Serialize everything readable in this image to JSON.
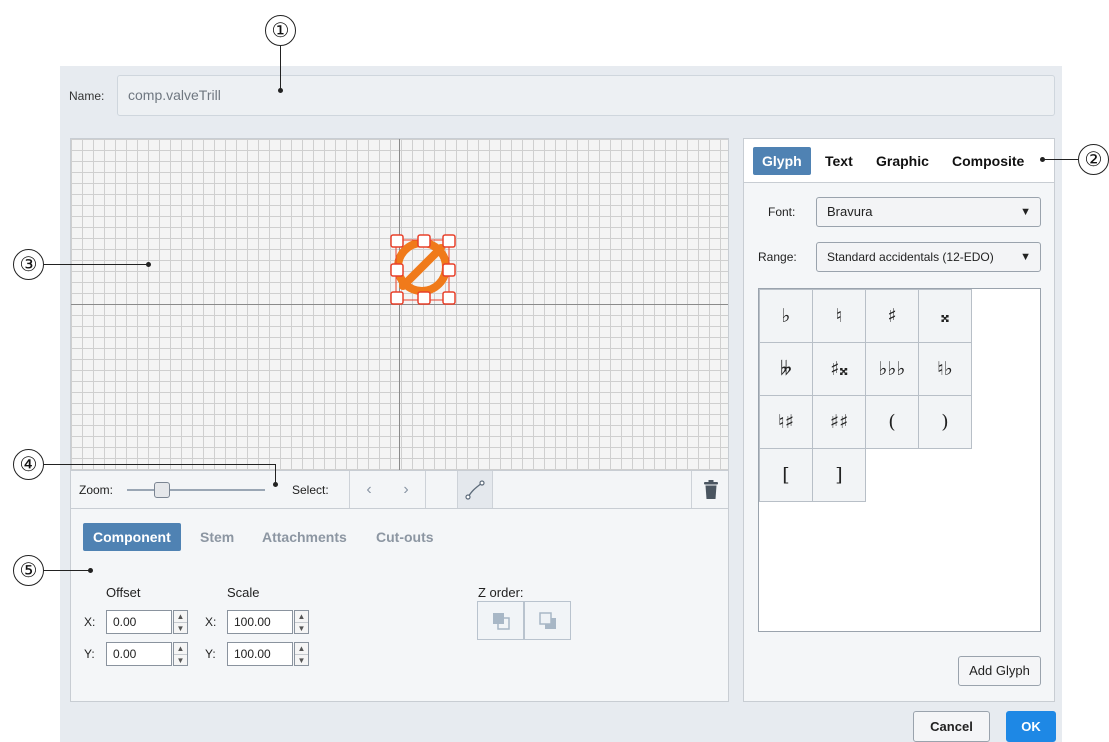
{
  "name": {
    "label": "Name:",
    "value": "comp.valveTrill"
  },
  "canvas_toolbar": {
    "zoom_label": "Zoom:",
    "zoom_level": 0.2,
    "select_label": "Select:",
    "prev_glyph": "‹",
    "next_glyph": "›"
  },
  "bottom_panel": {
    "tabs": [
      "Component",
      "Stem",
      "Attachments",
      "Cut-outs"
    ],
    "active_tab": "Component",
    "offset": {
      "label": "Offset",
      "x_label": "X:",
      "x": "0.00",
      "y_label": "Y:",
      "y": "0.00"
    },
    "scale": {
      "label": "Scale",
      "x_label": "X:",
      "x": "100.00",
      "y_label": "Y:",
      "y": "100.00"
    },
    "z_order": {
      "label": "Z order:"
    }
  },
  "right_panel": {
    "tabs": [
      "Glyph",
      "Text",
      "Graphic",
      "Composite"
    ],
    "active_tab": "Glyph",
    "font": {
      "label": "Font:",
      "value": "Bravura"
    },
    "range": {
      "label": "Range:",
      "value": "Standard accidentals (12-EDO)"
    },
    "glyphs": [
      "♭",
      "♮",
      "♯",
      "𝄪",
      "𝄫",
      "♯𝄪",
      "♭♭♭",
      "♮♭",
      "♮♯",
      "♯♯",
      "(",
      ")",
      "[",
      "]"
    ],
    "add_glyph_label": "Add Glyph"
  },
  "footer": {
    "cancel_label": "Cancel",
    "ok_label": "OK"
  },
  "callouts": [
    "①",
    "②",
    "③",
    "④",
    "⑤"
  ],
  "colors": {
    "accent": "#4f82b3",
    "ok": "#1e88e5",
    "selection": "#f07a1a",
    "handle_border": "#e8402a"
  }
}
